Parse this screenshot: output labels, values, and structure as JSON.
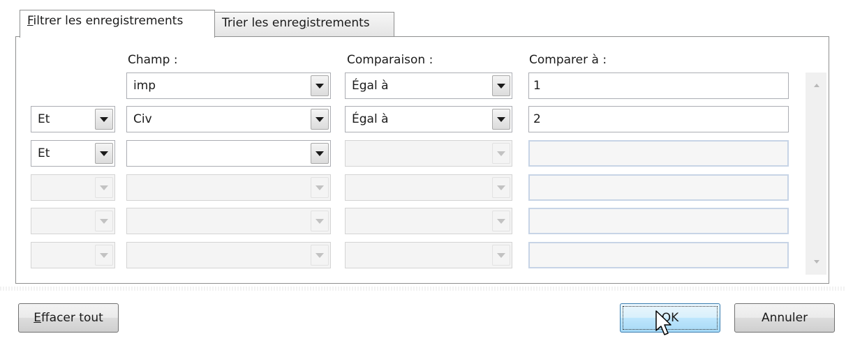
{
  "tabs": [
    {
      "label_accel": "F",
      "label_rest": "iltrer les enregistrements",
      "active": true
    },
    {
      "label_pre": "Trier les enre",
      "label_accel": "g",
      "label_rest": "istrements",
      "active": false
    }
  ],
  "headers": {
    "field": "Champ :",
    "comparison": "Comparaison :",
    "compare_to": "Comparer à :"
  },
  "rows": [
    {
      "connector": "",
      "field": "imp",
      "comparison": "Égal à",
      "value": "1"
    },
    {
      "connector": "Et",
      "field": "Civ",
      "comparison": "Égal à",
      "value": "2"
    },
    {
      "connector": "Et",
      "field": "",
      "comparison": "",
      "value": ""
    },
    {
      "connector": "",
      "field": "",
      "comparison": "",
      "value": ""
    },
    {
      "connector": "",
      "field": "",
      "comparison": "",
      "value": ""
    },
    {
      "connector": "",
      "field": "",
      "comparison": "",
      "value": ""
    }
  ],
  "buttons": {
    "clear_accel": "E",
    "clear_rest": "ffacer tout",
    "ok": "OK",
    "cancel": "Annuler"
  },
  "icons": {
    "dropdown": "chevron-down-icon",
    "scroll_up": "scroll-up-arrow-icon",
    "scroll_down": "scroll-down-arrow-icon",
    "cursor": "mouse-pointer-icon"
  }
}
